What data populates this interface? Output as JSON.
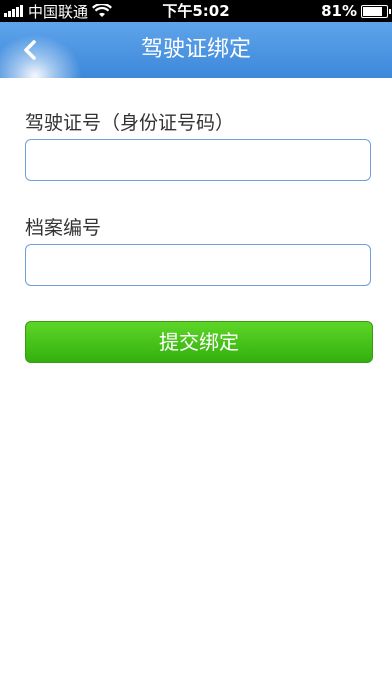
{
  "status_bar": {
    "carrier": "中国联通",
    "time": "下午5:02",
    "battery": "81%",
    "battery_level": 0.81
  },
  "nav": {
    "title": "驾驶证绑定"
  },
  "form": {
    "license_label": "驾驶证号（身份证号码）",
    "license_value": "",
    "license_placeholder": "",
    "record_label": "档案编号",
    "record_value": "",
    "record_placeholder": "",
    "submit_label": "提交绑定"
  },
  "colors": {
    "nav_bar": "#4a92e0",
    "submit_button": "#46c31b",
    "input_border": "#6fa0d8"
  }
}
